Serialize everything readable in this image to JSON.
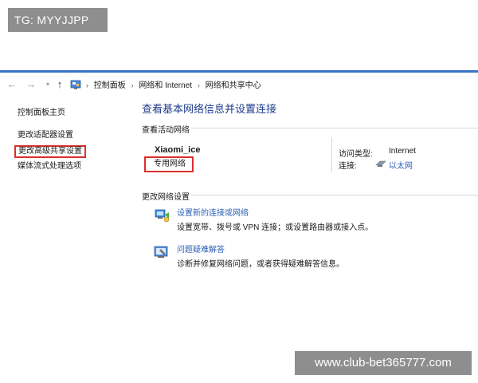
{
  "watermarks": {
    "top": "TG: MYYJJPP",
    "bottom": "www.club-bet365777.com"
  },
  "nav": {
    "back_icon": "back-arrow-icon",
    "forward_icon": "forward-arrow-icon",
    "up_icon": "up-arrow-icon"
  },
  "breadcrumb": [
    "控制面板",
    "网络和 Internet",
    "网络和共享中心"
  ],
  "sidebar": {
    "items": [
      {
        "label": "控制面板主页"
      },
      {
        "label": "更改适配器设置"
      },
      {
        "label": "更改高级共享设置"
      },
      {
        "label": "媒体流式处理选项"
      }
    ]
  },
  "main": {
    "title": "查看基本网络信息并设置连接",
    "active_section": "查看活动网络",
    "network": {
      "name": "Xiaomi_ice",
      "type": "专用网络",
      "access_label": "访问类型:",
      "access_value": "Internet",
      "connection_label": "连接:",
      "connection_value": "以太网"
    },
    "change_section": "更改网络设置",
    "tasks": [
      {
        "title": "设置新的连接或网络",
        "desc": "设置宽带、拨号或 VPN 连接；或设置路由器或接入点。"
      },
      {
        "title": "问题疑难解答",
        "desc": "诊断并修复网络问题，或者获得疑难解答信息。"
      }
    ]
  },
  "colors": {
    "accent": "#3a73c9",
    "link": "#2c5fb8",
    "highlight_box": "#d9302c",
    "title": "#1e3c8c"
  }
}
